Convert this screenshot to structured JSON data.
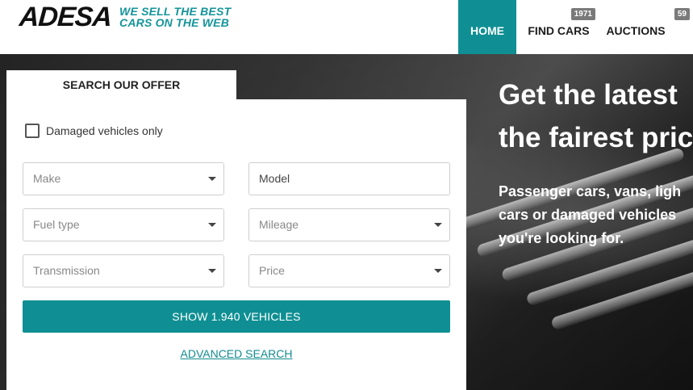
{
  "logo": {
    "text": "ADESA",
    "tagline_line1": "WE SELL THE BEST",
    "tagline_line2": "CARS ON THE WEB"
  },
  "nav": {
    "items": [
      {
        "label": "HOME",
        "active": true
      },
      {
        "label": "FIND CARS",
        "badge": "1971"
      },
      {
        "label": "AUCTIONS",
        "badge": "59"
      }
    ]
  },
  "hero": {
    "title_line1": "Get the latest",
    "title_line2": "the fairest pric",
    "sub_line1": "Passenger cars, vans, ligh",
    "sub_line2": "cars or damaged vehicles",
    "sub_line3": "you're looking for."
  },
  "search": {
    "tab_label": "SEARCH OUR OFFER",
    "damaged_label": "Damaged vehicles only",
    "damaged_checked": false,
    "make_placeholder": "Make",
    "model_value": "Model",
    "fuel_placeholder": "Fuel type",
    "mileage_placeholder": "Mileage",
    "transmission_placeholder": "Transmission",
    "price_placeholder": "Price",
    "show_button": "SHOW 1.940 VEHICLES",
    "advanced_link": "ADVANCED SEARCH"
  },
  "colors": {
    "accent": "#0f8f93",
    "badge": "#7a7a7a",
    "link": "#138b90"
  },
  "icons": {
    "dropdown": "caret-down-icon",
    "logo_star": "star-icon"
  }
}
